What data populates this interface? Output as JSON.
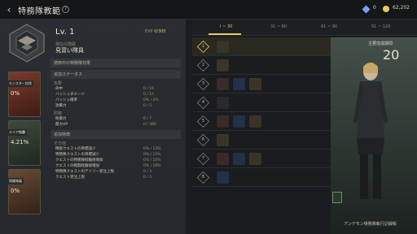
{
  "header": {
    "back_label": "‹",
    "title": "特務隊教範",
    "help": "?",
    "currency": [
      {
        "icon": "blue-gem-icon",
        "color": "#7aa0ff",
        "value": "0"
      },
      {
        "icon": "gold-coin-icon",
        "color": "#e6c860",
        "value": "62,202"
      }
    ]
  },
  "profile": {
    "level": "Lv. 1",
    "exp_label": "EXP",
    "exp_value": "0/300",
    "rank_label": "現在の階級",
    "rank": "見習い隊員"
  },
  "cards": [
    {
      "tag": "モンスター討伐",
      "pct": "0%"
    },
    {
      "tag": "エリア制覇",
      "pct": "4.21%"
    },
    {
      "tag": "知識発展",
      "pct": "0%"
    }
  ],
  "stats": {
    "header": "適用中の特務隊効果",
    "bonus_header": "追加ステータス",
    "attack_label": "攻撃",
    "attack": [
      {
        "k": "命中",
        "v": "0 / 16"
      },
      {
        "k": "バッシュダメージ",
        "v": "0 / 15"
      },
      {
        "k": "バッシュ確率",
        "v": "0% / 2%"
      },
      {
        "k": "攻撃力",
        "v": "0 / 5"
      }
    ],
    "defense_label": "防御",
    "defense": [
      {
        "k": "防御力",
        "v": "0 / 7"
      },
      {
        "k": "最大HP",
        "v": "0 / 380"
      }
    ],
    "special_header": "追加特典",
    "other_label": "その他",
    "other": [
      {
        "k": "精鋭クエストの目標減少",
        "v": "0% / 13%"
      },
      {
        "k": "特務隊クエストの目標減少",
        "v": "0% / 13%"
      },
      {
        "k": "クエストの特務隊経験値増加",
        "v": "0% / 10%"
      },
      {
        "k": "クエストの戦闘経験値増加",
        "v": "0% / 10%"
      },
      {
        "k": "特務隊クエストのデイリー受注上限",
        "v": "0 / 3"
      },
      {
        "k": "クエスト受注上限",
        "v": "0 / 3"
      }
    ]
  },
  "tabs": [
    "Ⅰ ~ 30",
    "31 ~ 60",
    "61 ~ 90",
    "91 ~ 120"
  ],
  "rows": [
    {
      "num": "1",
      "icons": [
        "chevron-rank-icon"
      ]
    },
    {
      "num": "2",
      "icons": [
        "rank-badge-icon"
      ]
    },
    {
      "num": "3",
      "icons": [
        "sword-icon",
        "potion-icon",
        "shield-icon"
      ]
    },
    {
      "num": "4",
      "icons": [
        "brush-icon"
      ]
    },
    {
      "num": "5",
      "icons": [
        "sword-icon",
        "potion-icon",
        "shield-icon"
      ]
    },
    {
      "num": "6",
      "icons": [
        "rank-badge-icon"
      ]
    },
    {
      "num": "7",
      "icons": [
        "sword-icon",
        "potion-icon",
        "shield-icon"
      ]
    },
    {
      "num": "8",
      "icons": [
        "potion-icon"
      ]
    }
  ],
  "character": {
    "label": "主要達成期間",
    "number": "20",
    "caption": "アンテモン特務隊執行記録帳"
  }
}
